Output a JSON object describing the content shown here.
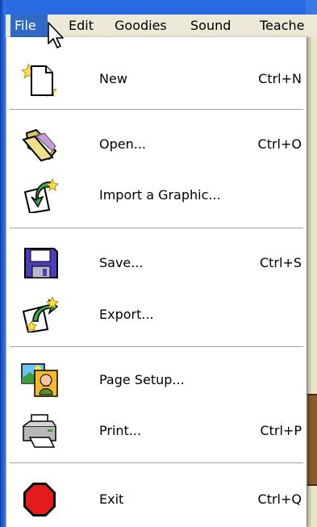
{
  "menubar": {
    "items": [
      "File",
      "Edit",
      "Goodies",
      "Sound",
      "Teache"
    ]
  },
  "file_menu": {
    "new": {
      "label": "New",
      "accel": "Ctrl+N"
    },
    "open": {
      "label": "Open...",
      "accel": "Ctrl+O"
    },
    "import": {
      "label": "Import a Graphic...",
      "accel": ""
    },
    "save": {
      "label": "Save...",
      "accel": "Ctrl+S"
    },
    "export": {
      "label": "Export...",
      "accel": ""
    },
    "page_setup": {
      "label": "Page Setup...",
      "accel": ""
    },
    "print": {
      "label": "Print...",
      "accel": "Ctrl+P"
    },
    "exit": {
      "label": "Exit",
      "accel": "Ctrl+Q"
    }
  },
  "icons": {
    "new": "new-document-icon",
    "open": "open-folder-icon",
    "import": "import-graphic-icon",
    "save": "floppy-disk-icon",
    "export": "export-icon",
    "page_setup": "page-setup-icon",
    "print": "printer-icon",
    "exit": "stop-sign-icon"
  },
  "colors": {
    "menu_highlight": "#316ac5",
    "menubar_bg": "#ece9d8",
    "menu_bg": "#ffffff"
  }
}
